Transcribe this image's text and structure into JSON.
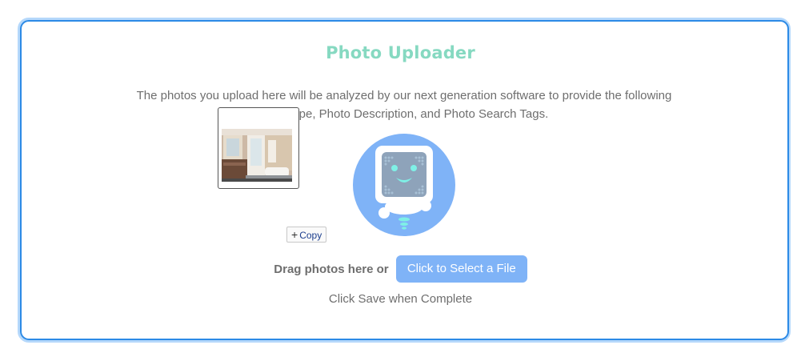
{
  "uploader": {
    "title": "Photo Uploader",
    "description_line1": "The photos you upload here will be analyzed by our next generation software to provide the following",
    "description_line2": "oom Type, Photo Description, and Photo Search Tags.",
    "drag_label": "Drag photos here or",
    "select_button": "Click to Select a File",
    "save_note": "Click Save when Complete"
  },
  "drag_overlay": {
    "copy_label": "Copy"
  },
  "colors": {
    "title": "#86d9c1",
    "panel_border": "#2c8ae6",
    "outer_border": "#b5d8fb",
    "button": "#7fb3f7",
    "robot_circle": "#7fb3f7",
    "text": "#6e6e6e"
  },
  "icons": {
    "robot": "robot-icon",
    "plus": "plus-icon",
    "thumbnail": "bathroom-photo-thumbnail"
  }
}
